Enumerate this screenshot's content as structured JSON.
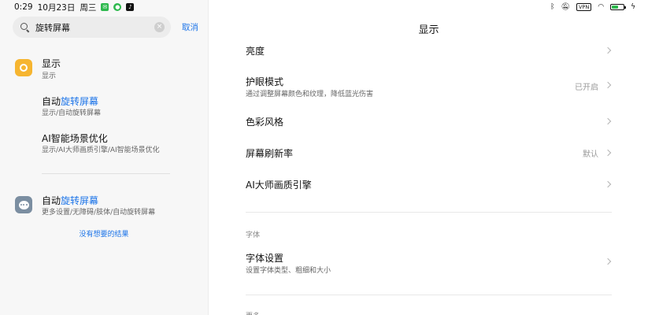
{
  "status_bar": {
    "time": "0:29",
    "date": "10月23日",
    "weekday": "周三",
    "app_icons": [
      "messages-icon",
      "wechat-icon",
      "tiktok-icon"
    ],
    "right_icons": [
      "bluetooth-icon",
      "mute-icon",
      "vpn-icon",
      "wifi-icon",
      "battery-icon",
      "charging-icon"
    ],
    "vpn_label": "VPN",
    "battery_level": 0.6
  },
  "search": {
    "query": "旋转屏幕",
    "cancel_label": "取消",
    "clear_glyph": "×"
  },
  "results": [
    {
      "icon": "sun-icon",
      "title_plain": "显示",
      "title_highlight": "",
      "subtitle": "显示"
    },
    {
      "icon": "",
      "title_plain": "自动",
      "title_highlight": "旋转屏幕",
      "subtitle": "显示/自动旋转屏幕"
    },
    {
      "icon": "",
      "title_plain": "AI智能场景优化",
      "title_highlight": "",
      "subtitle": "显示/AI大师画质引擎/AI智能场景优化"
    },
    {
      "icon": "more-settings-icon",
      "title_plain": "自动",
      "title_highlight": "旋转屏幕",
      "subtitle": "更多设置/无障碍/肢体/自动旋转屏幕"
    }
  ],
  "no_result_link": "没有想要的结果",
  "detail": {
    "title": "显示",
    "rows": [
      {
        "label": "亮度",
        "desc": "",
        "value": ""
      },
      {
        "label": "护眼模式",
        "desc": "通过调整屏幕颜色和纹理，降低蓝光伤害",
        "value": "已开启"
      },
      {
        "label": "色彩风格",
        "desc": "",
        "value": ""
      },
      {
        "label": "屏幕刷新率",
        "desc": "",
        "value": "默认"
      },
      {
        "label": "AI大师画质引擎",
        "desc": "",
        "value": ""
      }
    ],
    "font_section": {
      "label": "字体",
      "rows": [
        {
          "label": "字体设置",
          "desc": "设置字体类型、粗细和大小",
          "value": ""
        }
      ]
    },
    "next_section_label": "更多"
  },
  "colors": {
    "accent": "#1a73e8",
    "left_bg": "#f7f7f7",
    "sun_icon": "#f6b530",
    "more_icon": "#7b8ea1"
  }
}
